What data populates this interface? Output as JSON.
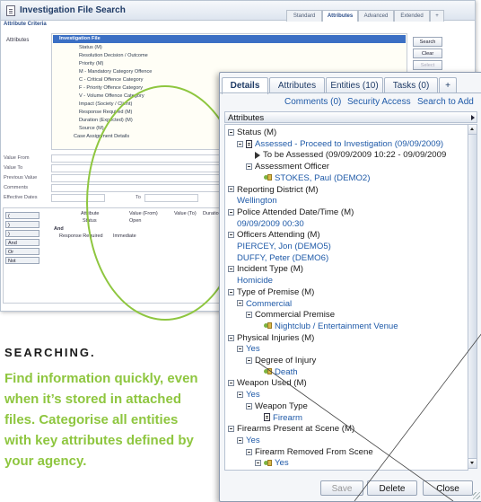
{
  "search_window": {
    "title": "Investigation File Search",
    "tabs": [
      "Standard",
      "Attributes",
      "Advanced",
      "Extended"
    ],
    "active_tab": "Attributes",
    "criteria_header": "Attribute Criteria",
    "attributes_label": "Attributes",
    "tree": [
      "Investigation File",
      "Status (M)",
      "Resolution Decision / Outcome",
      "Priority (M)",
      "M - Mandatory Category Offence",
      "C - Critical Offence Category",
      "F - Priority Offence Category",
      "V - Volume Offence Category",
      "Impact (Society / Client)",
      "Response Required (M)",
      "Duration (Expected) (M)",
      "Source (M)",
      "Case Assignment Details"
    ],
    "buttons": [
      "Search",
      "Clear",
      "Select"
    ],
    "form_labels": [
      "Value From",
      "Value To",
      "Previous Value",
      "Comments",
      "Effective Dates"
    ],
    "effective_to": "To",
    "table_headers": [
      "Attribute",
      "Value (From)",
      "Value (To)",
      "Duration Pri"
    ],
    "table_rows": [
      {
        "attribute": "Status",
        "value_from": "Open"
      },
      {
        "attribute": "Response Required",
        "value_from": "Immediate"
      }
    ],
    "connector_and": "And",
    "side_buttons": [
      "(",
      ")",
      ")",
      "And",
      "Or",
      "Not"
    ]
  },
  "caption": {
    "heading": "SEARCHING.",
    "body": "Find information quickly, even when it’s stored in attached files. Categorise all entities with key attributes defined by your agency."
  },
  "details_window": {
    "tabs": [
      {
        "label": "Details",
        "active": true
      },
      {
        "label": "Attributes",
        "active": false
      },
      {
        "label": "Entities (10)",
        "active": false
      },
      {
        "label": "Tasks (0)",
        "active": false
      },
      {
        "label": "+",
        "active": false
      }
    ],
    "links": [
      "Comments (0)",
      "Security Access",
      "Search to Add"
    ],
    "attributes_header": "Attributes",
    "items": [
      {
        "indent": 0,
        "kind": "header",
        "text": "Status (M)"
      },
      {
        "indent": 1,
        "kind": "doc",
        "text": "Assessed - Proceed to Investigation  (09/09/2009)"
      },
      {
        "indent": 3,
        "kind": "arrow",
        "text": "To be Assessed  (09/09/2009 10:22 - 09/09/2009"
      },
      {
        "indent": 2,
        "kind": "header",
        "text": "Assessment Officer"
      },
      {
        "indent": 4,
        "kind": "entity",
        "text": "STOKES, Paul  (DEMO2)"
      },
      {
        "indent": 0,
        "kind": "header",
        "text": "Reporting District (M)"
      },
      {
        "indent": 1,
        "kind": "value",
        "text": "Wellington"
      },
      {
        "indent": 0,
        "kind": "header",
        "text": "Police Attended Date/Time (M)"
      },
      {
        "indent": 1,
        "kind": "value",
        "text": "09/09/2009 00:30"
      },
      {
        "indent": 0,
        "kind": "header",
        "text": "Officers Attending (M)"
      },
      {
        "indent": 1,
        "kind": "value",
        "text": "PIERCEY, Jon  (DEMO5)"
      },
      {
        "indent": 1,
        "kind": "value",
        "text": "DUFFY, Peter  (DEMO6)"
      },
      {
        "indent": 0,
        "kind": "header",
        "text": "Incident Type (M)"
      },
      {
        "indent": 1,
        "kind": "value",
        "text": "Homicide"
      },
      {
        "indent": 0,
        "kind": "header",
        "text": "Type of Premise (M)"
      },
      {
        "indent": 1,
        "kind": "subheader",
        "text": "Commercial"
      },
      {
        "indent": 2,
        "kind": "header",
        "text": "Commercial Premise"
      },
      {
        "indent": 4,
        "kind": "entity",
        "text": "Nightclub / Entertainment Venue"
      },
      {
        "indent": 0,
        "kind": "header",
        "text": "Physical Injuries (M)"
      },
      {
        "indent": 1,
        "kind": "subheader",
        "text": "Yes"
      },
      {
        "indent": 2,
        "kind": "header",
        "text": "Degree of Injury"
      },
      {
        "indent": 4,
        "kind": "entity",
        "text": "Death"
      },
      {
        "indent": 0,
        "kind": "header",
        "text": "Weapon Used (M)"
      },
      {
        "indent": 1,
        "kind": "subheader",
        "text": "Yes"
      },
      {
        "indent": 2,
        "kind": "header",
        "text": "Weapon Type"
      },
      {
        "indent": 4,
        "kind": "doc",
        "text": "Firearm"
      },
      {
        "indent": 0,
        "kind": "header",
        "text": "Firearms Present at Scene (M)"
      },
      {
        "indent": 1,
        "kind": "subheader",
        "text": "Yes"
      },
      {
        "indent": 2,
        "kind": "header",
        "text": "Firearm Removed From Scene"
      },
      {
        "indent": 3,
        "kind": "entity-minus",
        "text": "Yes"
      }
    ],
    "buttons": {
      "save": "Save",
      "delete": "Delete",
      "close": "Close"
    }
  },
  "colors": {
    "accent_green": "#8ec63f",
    "link_blue": "#1f5aa8",
    "selection_blue": "#3b6fc4"
  }
}
